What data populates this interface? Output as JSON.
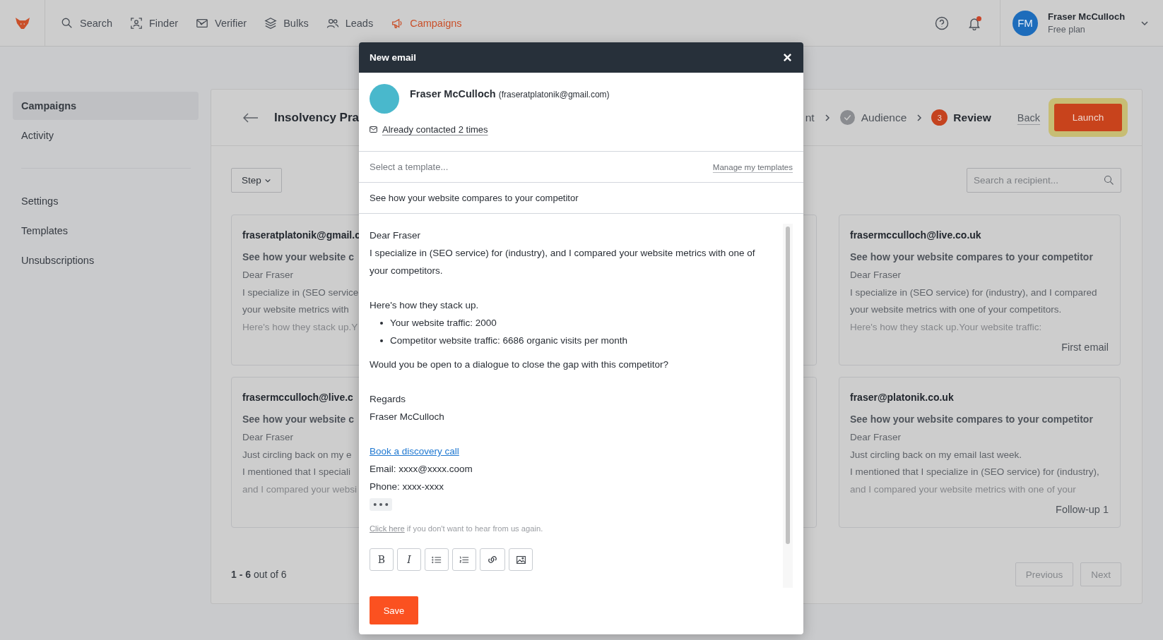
{
  "nav": {
    "items": [
      {
        "label": "Search",
        "selected": false
      },
      {
        "label": "Finder",
        "selected": false
      },
      {
        "label": "Verifier",
        "selected": false
      },
      {
        "label": "Bulks",
        "selected": false
      },
      {
        "label": "Leads",
        "selected": false
      },
      {
        "label": "Campaigns",
        "selected": true
      }
    ],
    "notifications_unread": true,
    "user": {
      "initials": "FM",
      "name": "Fraser McCulloch",
      "plan": "Free plan"
    }
  },
  "sidebar": {
    "groups": [
      [
        {
          "label": "Campaigns",
          "selected": true
        },
        {
          "label": "Activity",
          "selected": false
        }
      ],
      [
        {
          "label": "Settings",
          "selected": false
        },
        {
          "label": "Templates",
          "selected": false
        },
        {
          "label": "Unsubscriptions",
          "selected": false
        }
      ]
    ]
  },
  "campaign": {
    "title": "Insolvency Pra",
    "steps": [
      {
        "label": "nt",
        "kind": "plain",
        "selected": false
      },
      {
        "label": "Audience",
        "kind": "check",
        "selected": false
      },
      {
        "label": "Review",
        "kind": "number",
        "number": "3",
        "selected": true
      }
    ],
    "back": "Back",
    "launch": "Launch",
    "launch_highlighted": true,
    "step_filter": "Step",
    "search_placeholder": "Search a recipient...",
    "card_rows": [
      [
        {
          "email": "fraseratplatonik@gmail.c",
          "subject": "See how your website c",
          "lines": [
            "Dear Fraser",
            "I specialize in (SEO service",
            "your website metrics with",
            "Here's how they stack up.Y"
          ]
        },
        {
          "email": "frasermcculloch@live.co.uk",
          "subject": "See how your website compares to your competitor",
          "lines": [
            "Dear Fraser",
            "I specialize in (SEO service) for (industry), and I compared",
            "your website metrics with one of your competitors.",
            "Here's how they stack up.Your website traffic:"
          ],
          "step": "First email"
        }
      ],
      [
        {
          "email": "frasermcculloch@live.c",
          "subject": "See how your website c",
          "lines": [
            "Dear Fraser",
            "Just circling back on my e",
            "I mentioned that I speciali",
            "and I compared your websi"
          ]
        },
        {
          "email": "fraser@platonik.co.uk",
          "subject": "See how your website compares to your competitor",
          "lines": [
            "Dear Fraser",
            "Just circling back on my email last week.",
            "I mentioned that I specialize in (SEO service) for (industry),",
            "and I compared your website metrics with one of your"
          ],
          "step": "Follow-up 1"
        }
      ]
    ],
    "pagination": {
      "range": "**1 - 6** out of 6",
      "previous": {
        "label": "Previous",
        "disabled": true
      },
      "next": {
        "label": "Next",
        "disabled": true
      }
    }
  },
  "modal": {
    "title": "New email",
    "recipient": {
      "name": "Fraser McCulloch",
      "email": "(fraseratplatonik@gmail.com)"
    },
    "contact_history": "Already contacted 2 times",
    "template_placeholder": "Select a template...",
    "manage_templates": "Manage my templates",
    "subject": "See how your website compares to your competitor",
    "body": [
      {
        "kind": "text",
        "text": "Dear Fraser"
      },
      {
        "kind": "text",
        "text": "I specialize in (SEO service) for (industry), and I compared your website metrics with one of your competitors."
      },
      {
        "kind": "blank"
      },
      {
        "kind": "text",
        "text": "Here's how they stack up."
      },
      {
        "kind": "bullets",
        "items": [
          "Your website traffic: 2000",
          "Competitor website traffic: 6686 organic visits  per month"
        ]
      },
      {
        "kind": "text",
        "text": "Would you be open to a dialogue to close the gap with this competitor?"
      },
      {
        "kind": "blank"
      },
      {
        "kind": "text",
        "text": "Regards"
      },
      {
        "kind": "text",
        "text": "Fraser McCulloch"
      },
      {
        "kind": "blank"
      },
      {
        "kind": "link",
        "text": "Book a discovery call"
      },
      {
        "kind": "text",
        "text": "Email: xxxx@xxxx.coom"
      },
      {
        "kind": "text",
        "text": "Phone: xxxx-xxxx"
      },
      {
        "kind": "ellipsis"
      },
      {
        "kind": "footer",
        "link": "Click here",
        "text": " if you don't want to hear from us again."
      }
    ],
    "toolbar": [
      {
        "kind": "bold",
        "label": "B"
      },
      {
        "kind": "italic",
        "label": "I"
      },
      {
        "kind": "bulleted-list"
      },
      {
        "kind": "numbered-list"
      },
      {
        "kind": "link"
      },
      {
        "kind": "image"
      }
    ],
    "save": "Save"
  }
}
